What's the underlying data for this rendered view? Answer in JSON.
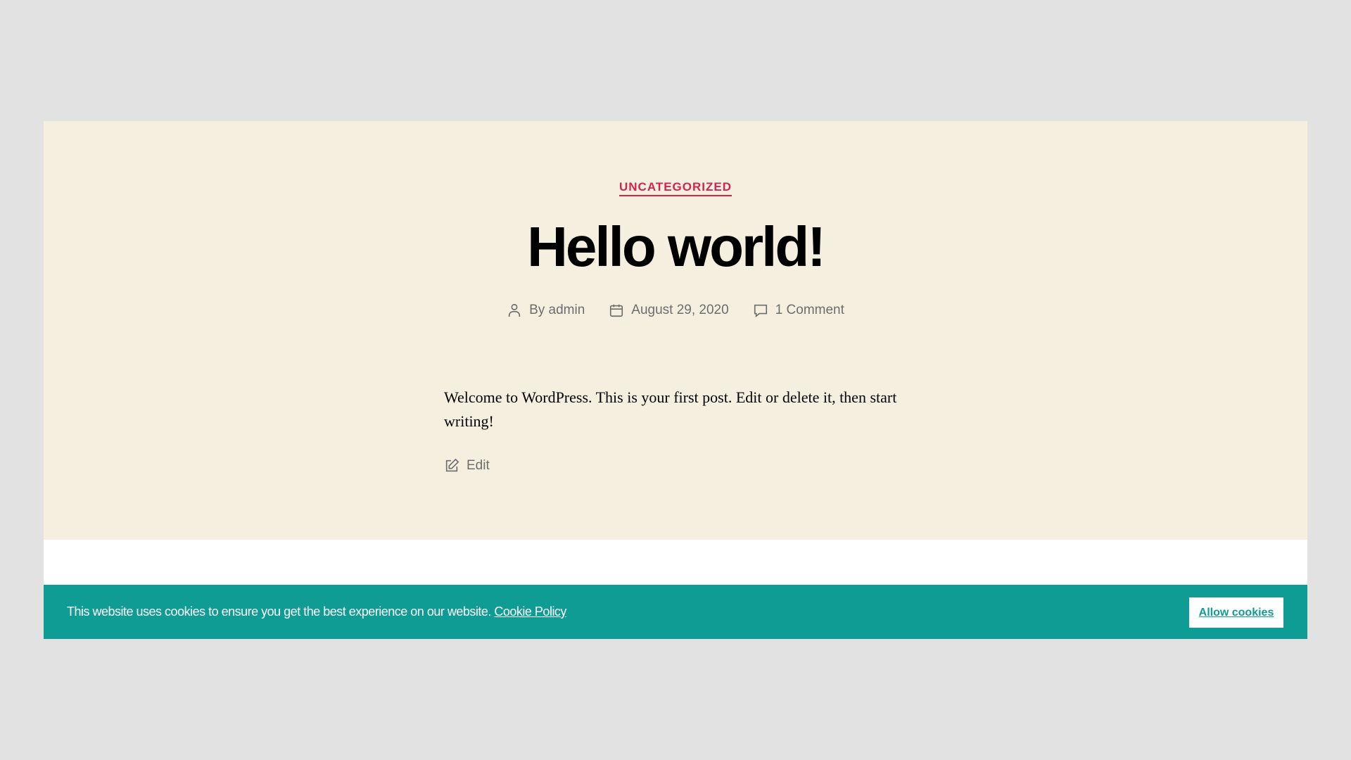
{
  "post": {
    "category": "UNCATEGORIZED",
    "title": "Hello world!",
    "author": "By admin",
    "date": "August 29, 2020",
    "comments": "1 Comment",
    "body": "Welcome to WordPress. This is your first post. Edit or delete it, then start writing!",
    "edit_label": "Edit"
  },
  "cookie_banner": {
    "message": "This website uses cookies to ensure you get the best experience on our website.",
    "policy_link": "Cookie Policy",
    "allow_label": "Allow cookies"
  },
  "colors": {
    "accent": "#cd2653",
    "banner": "#0e9c95",
    "card": "#f5efe0"
  }
}
